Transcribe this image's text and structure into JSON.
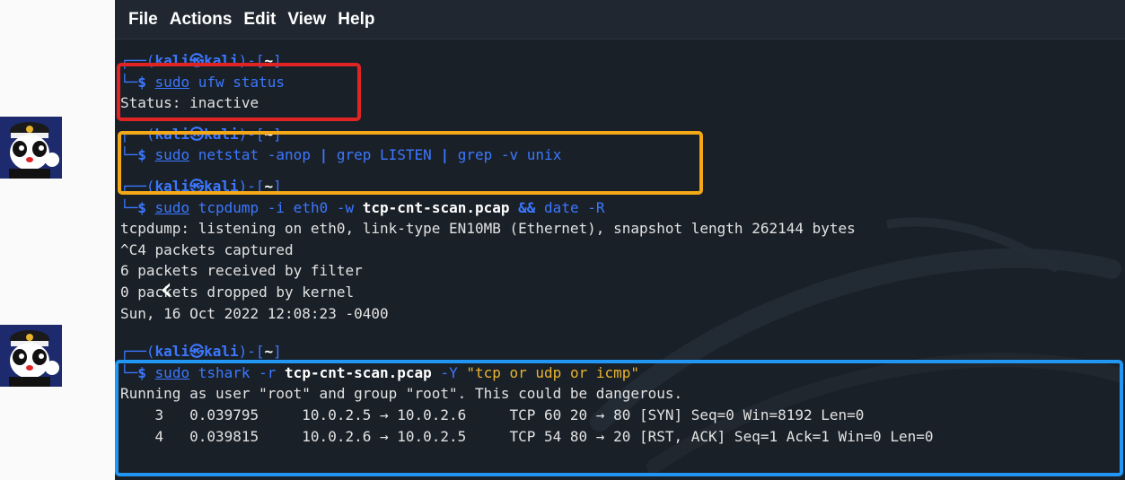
{
  "menu": [
    "File",
    "Actions",
    "Edit",
    "View",
    "Help"
  ],
  "prompt": {
    "top": "┌──(",
    "user": "kali",
    "at": "㉿",
    "host": "kali",
    "mid": ")-[",
    "dir": "~",
    "end": "]",
    "bottom": "└─",
    "dollar": "$"
  },
  "commands": [
    {
      "sudo": "sudo",
      "command": "ufw status",
      "output": [
        "Status: inactive"
      ]
    },
    {
      "sudo": "sudo",
      "cmd1": "netstat -anop ",
      "pipe1": "|",
      "cmd2": " grep LISTEN ",
      "pipe2": "|",
      "cmd3": " grep -v unix",
      "output": []
    },
    {
      "sudo": "sudo",
      "cmd1": "tcpdump -i eth0 -w ",
      "file": "tcp-cnt-scan.pcap",
      "amp": " && ",
      "cmd2": "date -R",
      "output": [
        "tcpdump: listening on eth0, link-type EN10MB (Ethernet), snapshot length 262144 bytes",
        "^C4 packets captured",
        "6 packets received by filter",
        "0 packets dropped by kernel",
        "Sun, 16 Oct 2022 12:08:23 -0400"
      ]
    },
    {
      "sudo": "sudo",
      "cmd1": "tshark -r ",
      "file": "tcp-cnt-scan.pcap",
      "flag": " -Y ",
      "filter": "\"tcp or udp or icmp\"",
      "output": [
        "Running as user \"root\" and group \"root\". This could be dangerous.",
        "    3   0.039795     10.0.2.5 → 10.0.2.6     TCP 60 20 → 80 [SYN] Seq=0 Win=8192 Len=0",
        "    4   0.039815     10.0.2.6 → 10.0.2.5     TCP 54 80 → 20 [RST, ACK] Seq=1 Ack=1 Win=0 Len=0"
      ]
    }
  ],
  "colors": {
    "terminal_bg": "#1a2028",
    "prompt_blue": "#3b78ff",
    "string_yellow": "#e8b430",
    "highlight_red": "#e02424",
    "highlight_orange": "#f3a917",
    "highlight_blue": "#2196f3"
  },
  "icons": {
    "avatar": "cartoon-cat-police-avatar-icon",
    "nav": "chevron-left-icon"
  }
}
